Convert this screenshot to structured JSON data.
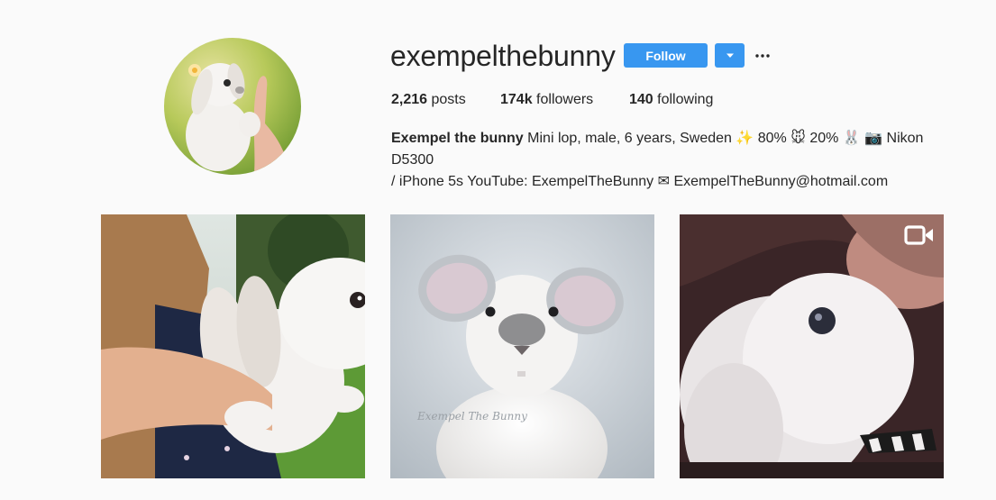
{
  "profile": {
    "username": "exempelthebunny",
    "follow_label": "Follow",
    "stats": {
      "posts_count": "2,216",
      "posts_label": "posts",
      "followers_count": "174k",
      "followers_label": "followers",
      "following_count": "140",
      "following_label": "following"
    },
    "bio": {
      "name": "Exempel the bunny",
      "line1": "Mini lop, male, 6 years, Sweden ✨ 80% 🐭 20% 🐰 📷 Nikon D5300",
      "line2": "/ iPhone 5s YouTube: ExempelTheBunny ✉ ExempelTheBunny@hotmail.com"
    }
  },
  "posts": [
    {
      "type": "photo"
    },
    {
      "type": "photo",
      "watermark": "Exempel The Bunny"
    },
    {
      "type": "video"
    }
  ],
  "colors": {
    "accent": "#3897f0",
    "background": "#fafafa",
    "text": "#262626"
  },
  "icons": {
    "dropdown": "chevron-down-icon",
    "more": "more-options-icon",
    "video": "video-camera-icon"
  }
}
